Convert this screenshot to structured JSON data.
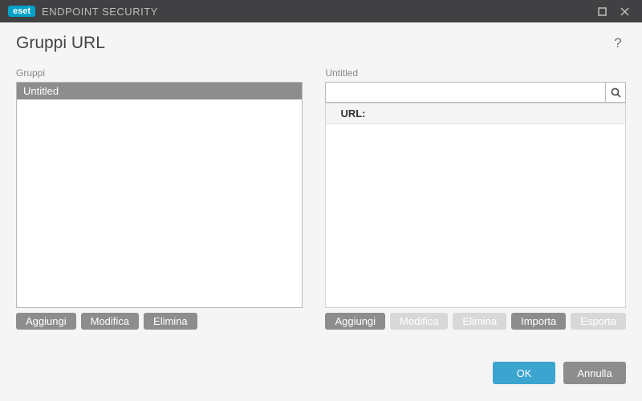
{
  "window": {
    "brand": "eset",
    "product": "ENDPOINT SECURITY"
  },
  "page": {
    "title": "Gruppi URL"
  },
  "left": {
    "label": "Gruppi",
    "items": [
      "Untitled"
    ],
    "buttons": {
      "add": "Aggiungi",
      "edit": "Modifica",
      "delete": "Elimina"
    }
  },
  "right": {
    "label": "Untitled",
    "search_placeholder": "",
    "column_header": "URL:",
    "buttons": {
      "add": "Aggiungi",
      "edit": "Modifica",
      "delete": "Elimina",
      "import": "Importa",
      "export": "Esporta"
    }
  },
  "footer": {
    "ok": "OK",
    "cancel": "Annulla"
  }
}
